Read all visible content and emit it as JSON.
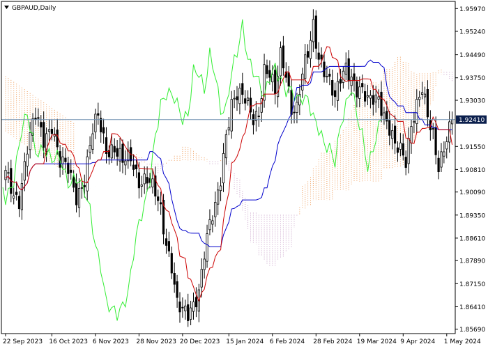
{
  "window": {
    "title": "GBPAUD,Daily"
  },
  "chart_data": {
    "type": "candlestick",
    "symbol": "GBPAUD",
    "timeframe": "Daily",
    "title": "GBPAUD,Daily",
    "current_price_label": "1.92410",
    "current_price": 1.9241,
    "ylim": [
      1.8555,
      1.962
    ],
    "grid": false,
    "y_ticks": [
      {
        "value": 1.9597,
        "label": "1.95970"
      },
      {
        "value": 1.9524,
        "label": "1.95240"
      },
      {
        "value": 1.9449,
        "label": "1.94490"
      },
      {
        "value": 1.9375,
        "label": "1.93750"
      },
      {
        "value": 1.9303,
        "label": "1.93030"
      },
      {
        "value": 1.9155,
        "label": "1.91550"
      },
      {
        "value": 1.9081,
        "label": "1.90810"
      },
      {
        "value": 1.9009,
        "label": "1.90090"
      },
      {
        "value": 1.8935,
        "label": "1.89350"
      },
      {
        "value": 1.8861,
        "label": "1.88610"
      },
      {
        "value": 1.8789,
        "label": "1.87890"
      },
      {
        "value": 1.8715,
        "label": "1.87150"
      },
      {
        "value": 1.8641,
        "label": "1.86410"
      },
      {
        "value": 1.8569,
        "label": "1.85690"
      }
    ],
    "x_ticks": [
      {
        "index": 0,
        "label": "22 Sep 2023"
      },
      {
        "index": 17,
        "label": "16 Oct 2023"
      },
      {
        "index": 33,
        "label": "6 Nov 2023"
      },
      {
        "index": 49,
        "label": "28 Nov 2023"
      },
      {
        "index": 65,
        "label": "20 Dec 2023"
      },
      {
        "index": 82,
        "label": "15 Jan 2024"
      },
      {
        "index": 98,
        "label": "6 Feb 2024"
      },
      {
        "index": 114,
        "label": "28 Feb 2024"
      },
      {
        "index": 130,
        "label": "19 Mar 2024"
      },
      {
        "index": 146,
        "label": "9 Apr 2024"
      },
      {
        "index": 162,
        "label": "1 May 2024"
      }
    ],
    "indicators": [
      "tenkan-sen",
      "kijun-sen",
      "chikou-span",
      "senkou-span-a",
      "senkou-span-b"
    ],
    "colors": {
      "candle": "#000000",
      "tenkan": "#cc0000",
      "kijun": "#0000cc",
      "chikou": "#33ee33",
      "cloud_up": "#f0a060",
      "cloud_down": "#c8a0c8",
      "price_line": "#7090b0",
      "price_label_bg": "#0b1f4d",
      "price_label_text": "#ffffff"
    },
    "close_anchors": [
      [
        0,
        1.9065
      ],
      [
        3,
        1.9
      ],
      [
        5,
        1.899
      ],
      [
        8,
        1.915
      ],
      [
        11,
        1.925
      ],
      [
        14,
        1.918
      ],
      [
        17,
        1.923
      ],
      [
        20,
        1.91
      ],
      [
        23,
        1.908
      ],
      [
        26,
        1.9
      ],
      [
        29,
        1.905
      ],
      [
        32,
        1.92
      ],
      [
        34,
        1.925
      ],
      [
        37,
        1.915
      ],
      [
        40,
        1.915
      ],
      [
        43,
        1.91
      ],
      [
        46,
        1.912
      ],
      [
        49,
        1.905
      ],
      [
        52,
        1.905
      ],
      [
        55,
        1.9
      ],
      [
        57,
        1.895
      ],
      [
        59,
        1.885
      ],
      [
        61,
        1.878
      ],
      [
        63,
        1.865
      ],
      [
        65,
        1.862
      ],
      [
        67,
        1.861
      ],
      [
        69,
        1.865
      ],
      [
        71,
        1.87
      ],
      [
        73,
        1.882
      ],
      [
        75,
        1.89
      ],
      [
        77,
        1.895
      ],
      [
        79,
        1.905
      ],
      [
        81,
        1.92
      ],
      [
        83,
        1.93
      ],
      [
        85,
        1.932
      ],
      [
        88,
        1.93
      ],
      [
        91,
        1.925
      ],
      [
        93,
        1.927
      ],
      [
        95,
        1.94
      ],
      [
        97,
        1.938
      ],
      [
        99,
        1.932
      ],
      [
        101,
        1.945
      ],
      [
        103,
        1.94
      ],
      [
        105,
        1.928
      ],
      [
        107,
        1.927
      ],
      [
        109,
        1.938
      ],
      [
        111,
        1.945
      ],
      [
        113,
        1.955
      ],
      [
        115,
        1.945
      ],
      [
        117,
        1.94
      ],
      [
        119,
        1.935
      ],
      [
        121,
        1.93
      ],
      [
        123,
        1.938
      ],
      [
        125,
        1.942
      ],
      [
        127,
        1.938
      ],
      [
        129,
        1.933
      ],
      [
        131,
        1.932
      ],
      [
        133,
        1.93
      ],
      [
        135,
        1.932
      ],
      [
        137,
        1.932
      ],
      [
        139,
        1.925
      ],
      [
        141,
        1.92
      ],
      [
        143,
        1.915
      ],
      [
        145,
        1.915
      ],
      [
        147,
        1.912
      ],
      [
        149,
        1.923
      ],
      [
        151,
        1.928
      ],
      [
        153,
        1.933
      ],
      [
        155,
        1.925
      ],
      [
        157,
        1.92
      ],
      [
        159,
        1.91
      ],
      [
        161,
        1.915
      ],
      [
        163,
        1.92
      ],
      [
        164,
        1.9241
      ]
    ],
    "candle_count": 165
  }
}
